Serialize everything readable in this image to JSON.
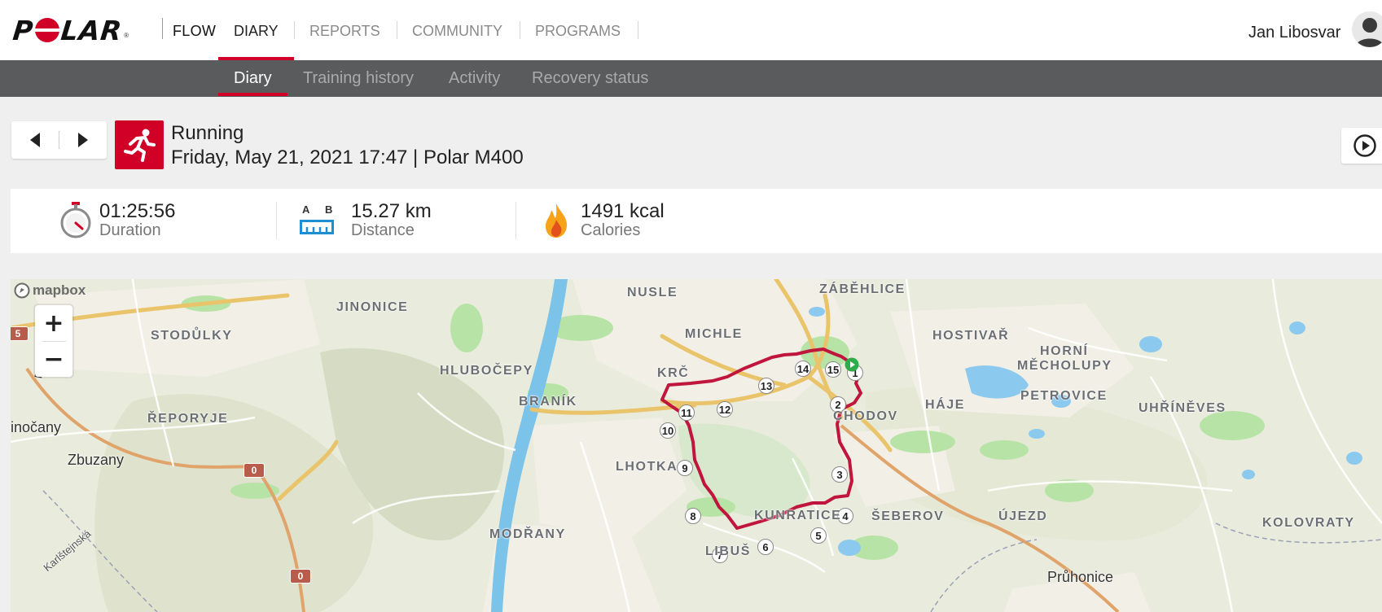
{
  "header": {
    "brand": "POLAR",
    "brand_parts": [
      "P",
      "LAR"
    ],
    "flow": "FLOW",
    "nav": [
      {
        "label": "DIARY",
        "active": true
      },
      {
        "label": "REPORTS",
        "active": false
      },
      {
        "label": "COMMUNITY",
        "active": false
      },
      {
        "label": "PROGRAMS",
        "active": false
      }
    ],
    "user_name": "Jan Libosvar",
    "accent_color": "#d10027"
  },
  "subnav": [
    {
      "label": "Diary",
      "active": true
    },
    {
      "label": "Training history",
      "active": false
    },
    {
      "label": "Activity",
      "active": false
    },
    {
      "label": "Recovery status",
      "active": false
    }
  ],
  "session": {
    "sport": "Running",
    "sport_icon": "running-person-icon",
    "meta": "Friday, May 21, 2021 17:47 | Polar M400"
  },
  "summary": {
    "duration": {
      "value": "01:25:56",
      "label": "Duration",
      "icon": "stopwatch-icon"
    },
    "distance": {
      "value": "15.27 km",
      "label": "Distance",
      "icon": "ruler-ab-icon",
      "a": "A",
      "b": "B"
    },
    "calories": {
      "value": "1491 kcal",
      "label": "Calories",
      "icon": "flame-icon"
    }
  },
  "map": {
    "attribution": "mapbox",
    "zoom_in": "+",
    "zoom_out": "−",
    "labels": {
      "nusle": "NUSLE",
      "zabehlice": "ZÁBĚHLICE",
      "jinonice": "JINONICE",
      "michle": "MICHLE",
      "hostivar": "HOSTIVAŘ",
      "stodulky": "STODŮLKY",
      "horni_mecholupy_1": "HORNÍ",
      "horni_mecholupy_2": "MĚCHOLUPY",
      "hlubocepy": "HLUBOČEPY",
      "krc": "KRČ",
      "branik": "BRANÍK",
      "petrovice": "PETROVICE",
      "hostivar_haje": "HÁJE",
      "uhrineves": "UHŘÍNĚVES",
      "chodov": "CHODOV",
      "reporyje": "ŘEPORYJE",
      "lhotka": "LHOTKA",
      "sebero v": "ŠEBEROV",
      "ujezd": "ÚJEZD",
      "kolovraty": "KOLOVRATY",
      "kunratice": "KUNRATICE",
      "modrany": "MODŘANY",
      "libus": "LIBUŠ",
      "inocany": "inočany",
      "zbuzany": "Zbuzany",
      "pruhonice": "Průhonice",
      "karlstejnska": "Karlštejnská",
      "p_label": "P"
    },
    "shields": [
      "5",
      "0",
      "0"
    ],
    "route_color": "#c0163d",
    "laps": [
      "1",
      "2",
      "3",
      "4",
      "5",
      "6",
      "7",
      "8",
      "9",
      "10",
      "11",
      "12",
      "13",
      "14",
      "15"
    ]
  }
}
